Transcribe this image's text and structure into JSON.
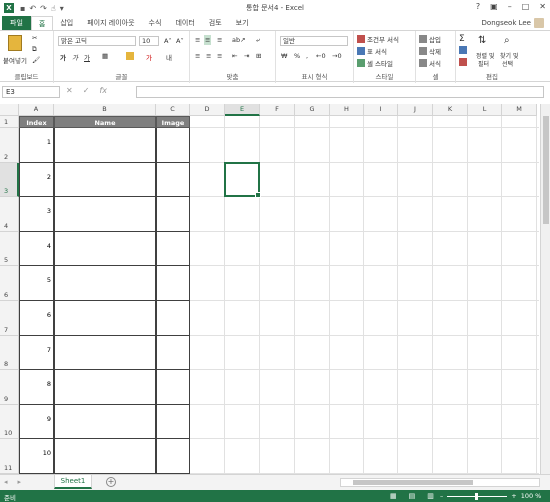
{
  "app": {
    "title": "통합 문서4 - Excel",
    "icon": "X",
    "user": "Dongseok Lee"
  },
  "tabs": [
    "파일",
    "홈",
    "삽입",
    "페이지 레이아웃",
    "수식",
    "데이터",
    "검토",
    "보기"
  ],
  "ribbon": {
    "clipboard": {
      "paste": "붙여넣기",
      "label": "클립보드"
    },
    "font": {
      "name": "맑은 고딕",
      "size": "10",
      "label": "글꼴"
    },
    "alignment": {
      "label": "맞춤"
    },
    "number": {
      "format": "일반",
      "label": "표시 형식"
    },
    "styles": {
      "conditional": "조건부 서식",
      "table": "표 서식",
      "cell": "셀 스타일",
      "label": "스타일"
    },
    "cells": {
      "insert": "삽입",
      "delete": "삭제",
      "format": "서식",
      "label": "셀"
    },
    "editing": {
      "sort": "정렬 및",
      "sort2": "필터",
      "find": "찾기 및",
      "find2": "선택",
      "label": "편집"
    }
  },
  "formula_bar": {
    "name_box": "E3",
    "value": ""
  },
  "columns": [
    "A",
    "B",
    "C",
    "D",
    "E",
    "F",
    "G",
    "H",
    "I",
    "J",
    "K",
    "L",
    "M"
  ],
  "rows": [
    "1",
    "2",
    "3",
    "4",
    "5",
    "6",
    "7",
    "8",
    "9",
    "10",
    "11"
  ],
  "table": {
    "headers": [
      "Index",
      "Name",
      "Image"
    ],
    "index_values": [
      "1",
      "2",
      "3",
      "4",
      "5",
      "6",
      "7",
      "8",
      "9",
      "10"
    ]
  },
  "sheet_tab": "Sheet1",
  "status": {
    "text": "준비",
    "zoom": "100 %"
  }
}
